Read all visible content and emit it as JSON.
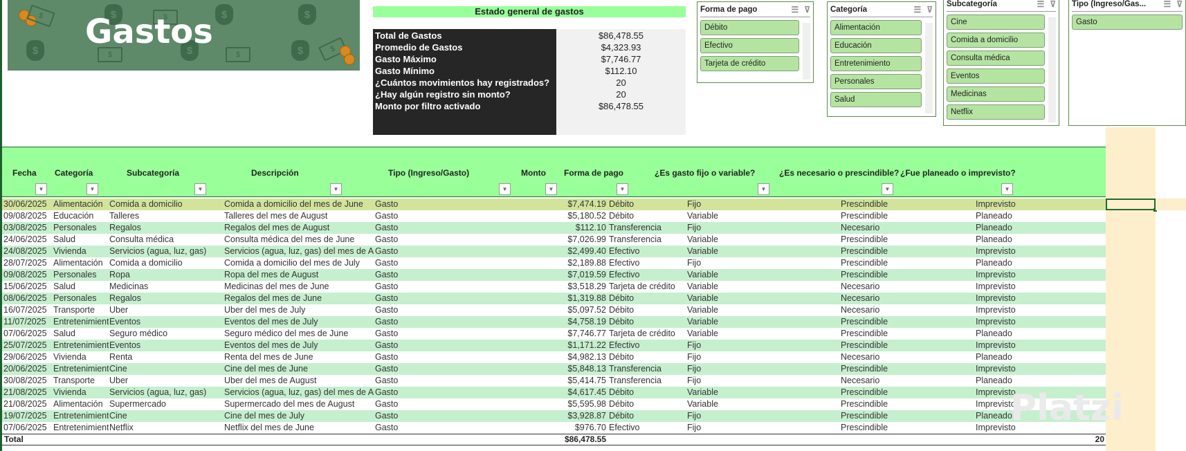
{
  "banner": {
    "title": "Gastos"
  },
  "stats": {
    "title": "Estado general de gastos",
    "items": [
      {
        "label": "Total de Gastos",
        "value": "$86,478.55"
      },
      {
        "label": "Promedio de Gastos",
        "value": "$4,323.93"
      },
      {
        "label": "Gasto Máximo",
        "value": "$7,746.77"
      },
      {
        "label": "Gasto Mínimo",
        "value": "$112.10"
      },
      {
        "label": "¿Cuántos movimientos hay registrados?",
        "value": "20"
      },
      {
        "label": "¿Hay algún registro sin monto?",
        "value": "20"
      },
      {
        "label": "Monto por filtro activado",
        "value": "$86,478.55"
      }
    ]
  },
  "slicers": [
    {
      "title": "Forma de pago",
      "items": [
        "Débito",
        "Efectivo",
        "Tarjeta de crédito"
      ]
    },
    {
      "title": "Categoría",
      "items": [
        "Alimentación",
        "Educación",
        "Entretenimiento",
        "Personales",
        "Salud"
      ]
    },
    {
      "title": "Subcategoría",
      "items": [
        "Cine",
        "Comida a domicilio",
        "Consulta médica",
        "Eventos",
        "Medicinas",
        "Netflix"
      ]
    },
    {
      "title": "Tipo (Ingreso/Gas...",
      "items": [
        "Gasto"
      ]
    }
  ],
  "table": {
    "headers": [
      "Fecha",
      "Categoría",
      "Subcategoría",
      "Descripción",
      "Tipo (Ingreso/Gasto)",
      "Monto",
      "Forma de pago",
      "¿Es gasto fijo o variable?",
      "¿Es necesario o prescindible?",
      "¿Fue planeado o imprevisto?"
    ],
    "rows": [
      [
        "30/06/2025",
        "Alimentación",
        "Comida a domicilio",
        "Comida a domicilio del mes de June",
        "Gasto",
        "$7,474.19",
        "Débito",
        "Fijo",
        "Prescindible",
        "Imprevisto"
      ],
      [
        "09/08/2025",
        "Educación",
        "Talleres",
        "Talleres del mes de August",
        "Gasto",
        "$5,180.52",
        "Débito",
        "Variable",
        "Prescindible",
        "Planeado"
      ],
      [
        "03/08/2025",
        "Personales",
        "Regalos",
        "Regalos del mes de August",
        "Gasto",
        "$112.10",
        "Transferencia",
        "Fijo",
        "Necesario",
        "Planeado"
      ],
      [
        "24/06/2025",
        "Salud",
        "Consulta médica",
        "Consulta médica del mes de June",
        "Gasto",
        "$7,026.99",
        "Transferencia",
        "Variable",
        "Prescindible",
        "Planeado"
      ],
      [
        "24/08/2025",
        "Vivienda",
        "Servicios (agua, luz, gas)",
        "Servicios (agua, luz, gas) del mes de August",
        "Gasto",
        "$2,499.40",
        "Efectivo",
        "Variable",
        "Prescindible",
        "Imprevisto"
      ],
      [
        "28/07/2025",
        "Alimentación",
        "Comida a domicilio",
        "Comida a domicilio del mes de July",
        "Gasto",
        "$2,189.88",
        "Efectivo",
        "Fijo",
        "Prescindible",
        "Planeado"
      ],
      [
        "09/08/2025",
        "Personales",
        "Ropa",
        "Ropa del mes de August",
        "Gasto",
        "$7,019.59",
        "Efectivo",
        "Variable",
        "Prescindible",
        "Imprevisto"
      ],
      [
        "15/06/2025",
        "Salud",
        "Medicinas",
        "Medicinas del mes de June",
        "Gasto",
        "$3,518.29",
        "Tarjeta de crédito",
        "Variable",
        "Necesario",
        "Imprevisto"
      ],
      [
        "08/06/2025",
        "Personales",
        "Regalos",
        "Regalos del mes de June",
        "Gasto",
        "$1,319.88",
        "Débito",
        "Variable",
        "Necesario",
        "Imprevisto"
      ],
      [
        "16/07/2025",
        "Transporte",
        "Uber",
        "Uber del mes de July",
        "Gasto",
        "$5,097.52",
        "Débito",
        "Variable",
        "Necesario",
        "Imprevisto"
      ],
      [
        "11/07/2025",
        "Entretenimiento",
        "Eventos",
        "Eventos del mes de July",
        "Gasto",
        "$4,758.19",
        "Débito",
        "Variable",
        "Prescindible",
        "Imprevisto"
      ],
      [
        "07/06/2025",
        "Salud",
        "Seguro médico",
        "Seguro médico del mes de June",
        "Gasto",
        "$7,746.77",
        "Tarjeta de crédito",
        "Variable",
        "Prescindible",
        "Planeado"
      ],
      [
        "25/07/2025",
        "Entretenimiento",
        "Eventos",
        "Eventos del mes de July",
        "Gasto",
        "$1,171.22",
        "Efectivo",
        "Fijo",
        "Prescindible",
        "Imprevisto"
      ],
      [
        "29/06/2025",
        "Vivienda",
        "Renta",
        "Renta del mes de June",
        "Gasto",
        "$4,982.13",
        "Débito",
        "Fijo",
        "Necesario",
        "Planeado"
      ],
      [
        "20/06/2025",
        "Entretenimiento",
        "Cine",
        "Cine del mes de June",
        "Gasto",
        "$5,848.13",
        "Transferencia",
        "Fijo",
        "Prescindible",
        "Imprevisto"
      ],
      [
        "30/08/2025",
        "Transporte",
        "Uber",
        "Uber del mes de August",
        "Gasto",
        "$5,414.75",
        "Transferencia",
        "Fijo",
        "Necesario",
        "Planeado"
      ],
      [
        "21/08/2025",
        "Vivienda",
        "Servicios (agua, luz, gas)",
        "Servicios (agua, luz, gas) del mes de August",
        "Gasto",
        "$4,617.45",
        "Débito",
        "Variable",
        "Prescindible",
        "Imprevisto"
      ],
      [
        "21/08/2025",
        "Alimentación",
        "Supermercado",
        "Supermercado del mes de August",
        "Gasto",
        "$5,595.98",
        "Débito",
        "Variable",
        "Prescindible",
        "Imprevisto"
      ],
      [
        "19/07/2025",
        "Entretenimiento",
        "Cine",
        "Cine del mes de July",
        "Gasto",
        "$3,928.87",
        "Débito",
        "Fijo",
        "Prescindible",
        "Planeado"
      ],
      [
        "07/06/2025",
        "Entretenimiento",
        "Netflix",
        "Netflix del mes de June",
        "Gasto",
        "$976.70",
        "Efectivo",
        "Fijo",
        "Prescindible",
        "Imprevisto"
      ]
    ],
    "total": {
      "label": "Total",
      "amount": "$86,478.55",
      "count": "20"
    }
  },
  "watermark": "Platzi"
}
